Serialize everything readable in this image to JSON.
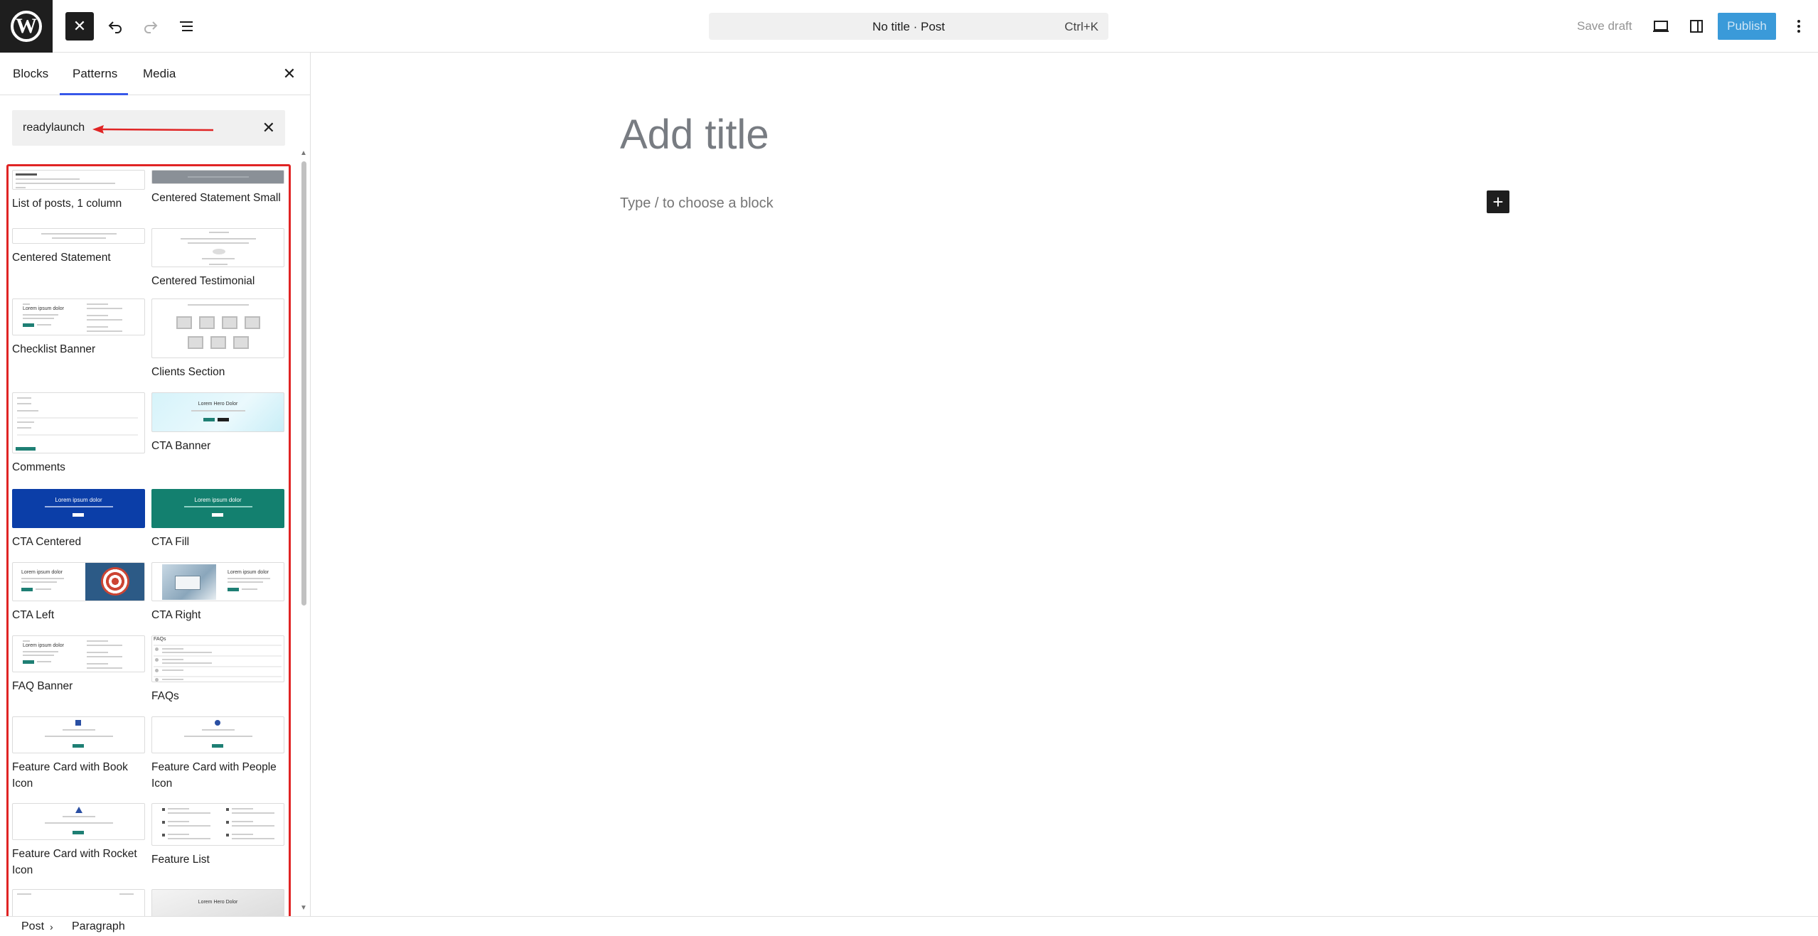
{
  "header": {
    "command_title": "No title · Post",
    "command_shortcut": "Ctrl+K",
    "save_draft": "Save draft",
    "publish": "Publish",
    "icons": [
      "wordpress-logo",
      "close-icon",
      "undo-icon",
      "redo-icon",
      "list-view-icon",
      "desktop-preview-icon",
      "settings-sidebar-icon",
      "more-options-icon"
    ]
  },
  "sidebar": {
    "tabs": [
      "Blocks",
      "Patterns",
      "Media"
    ],
    "active_tab": "Patterns",
    "search_value": "readylaunch",
    "patterns": [
      "List of posts, 1 column",
      "Centered Statement Small",
      "Centered Statement",
      "Centered Testimonial",
      "Checklist Banner",
      "Clients Section",
      "Comments",
      "CTA Banner",
      "CTA Centered",
      "CTA Fill",
      "CTA Left",
      "CTA Right",
      "FAQ Banner",
      "FAQs",
      "Feature Card with Book Icon",
      "Feature Card with People Icon",
      "Feature Card with Rocket Icon",
      "Feature List"
    ],
    "thumb_text": {
      "lorem": "Lorem ipsum dolor",
      "hero": "Lorem Hero Dolor",
      "faqs": "FAQs"
    }
  },
  "editor": {
    "title_placeholder": "Add title",
    "block_placeholder": "Type / to choose a block"
  },
  "footer": {
    "breadcrumb": [
      "Post",
      "Paragraph"
    ]
  },
  "colors": {
    "accent": "#3858e9",
    "publish": "#3a9ad9",
    "highlight_border": "#e02424",
    "cta_blue": "#0b3ea8",
    "cta_teal": "#13806f"
  }
}
